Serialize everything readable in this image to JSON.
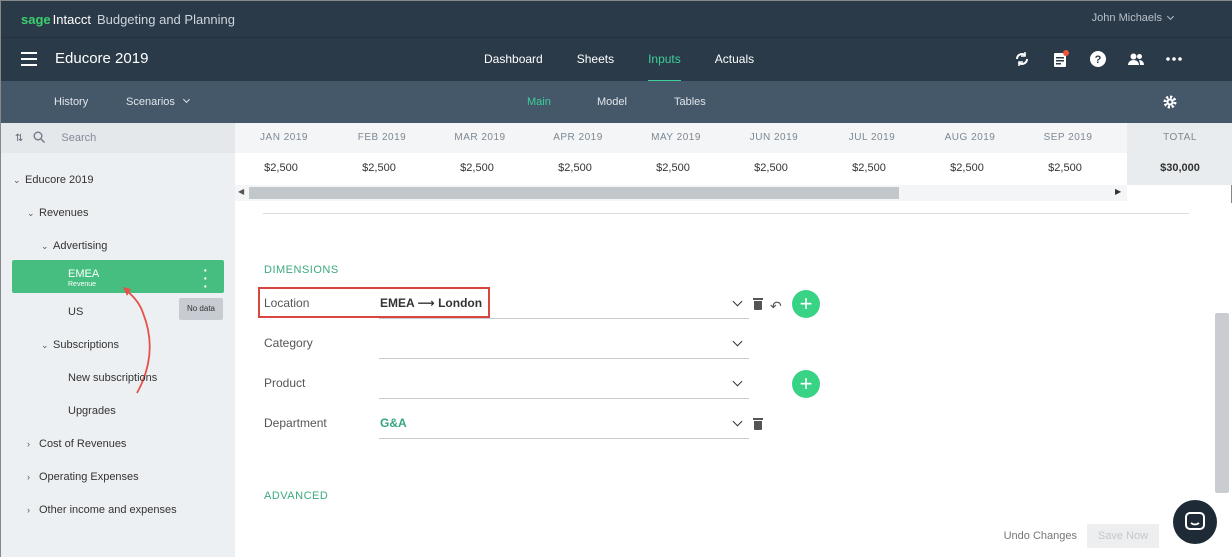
{
  "brand": {
    "sage": "sage",
    "intacct": "Intacct",
    "product": "Budgeting and Planning"
  },
  "user": {
    "name": "John Michaels"
  },
  "app": {
    "title": "Educore 2019"
  },
  "main_tabs": [
    {
      "label": "Dashboard",
      "active": false
    },
    {
      "label": "Sheets",
      "active": false
    },
    {
      "label": "Inputs",
      "active": true
    },
    {
      "label": "Actuals",
      "active": false
    }
  ],
  "subbar": {
    "history": "History",
    "scenarios": "Scenarios",
    "tabs": [
      {
        "label": "Main",
        "active": true
      },
      {
        "label": "Model",
        "active": false
      },
      {
        "label": "Tables",
        "active": false
      }
    ]
  },
  "sidebar": {
    "search_placeholder": "Search",
    "tree": [
      {
        "label": "Educore 2019",
        "level": 0,
        "caret": "down"
      },
      {
        "label": "Revenues",
        "level": 1,
        "caret": "down"
      },
      {
        "label": "Advertising",
        "level": 2,
        "caret": "down"
      },
      {
        "label": "US",
        "level": 3,
        "caret": "none"
      },
      {
        "label": "Subscriptions",
        "level": 2,
        "caret": "down"
      },
      {
        "label": "New subscriptions",
        "level": 3,
        "caret": "none"
      },
      {
        "label": "Upgrades",
        "level": 3,
        "caret": "none"
      },
      {
        "label": "Cost of Revenues",
        "level": 1,
        "caret": "right"
      },
      {
        "label": "Operating Expenses",
        "level": 1,
        "caret": "right"
      },
      {
        "label": "Other income and expenses",
        "level": 1,
        "caret": "right"
      }
    ],
    "selected": {
      "label": "EMEA",
      "sublabel": "Revenue"
    },
    "nodata_tooltip": "No data"
  },
  "grid": {
    "months": [
      "JAN 2019",
      "FEB 2019",
      "MAR 2019",
      "APR 2019",
      "MAY 2019",
      "JUN 2019",
      "JUL 2019",
      "AUG 2019",
      "SEP 2019"
    ],
    "values": [
      "$2,500",
      "$2,500",
      "$2,500",
      "$2,500",
      "$2,500",
      "$2,500",
      "$2,500",
      "$2,500",
      "$2,500"
    ],
    "total_label": "TOTAL",
    "total_value": "$30,000"
  },
  "dimensions": {
    "title": "DIMENSIONS",
    "rows": [
      {
        "label": "Location",
        "value": "EMEA ⟶ London"
      },
      {
        "label": "Category",
        "value": ""
      },
      {
        "label": "Product",
        "value": ""
      },
      {
        "label": "Department",
        "value": "G&A"
      }
    ]
  },
  "advanced": {
    "title": "ADVANCED"
  },
  "footer": {
    "undo": "Undo Changes",
    "save": "Save Now"
  },
  "colors": {
    "accent": "#3ccf9a",
    "nav": "#2b3a48",
    "subnav": "#44586a",
    "selected": "#46be80",
    "highlight": "#d9453f"
  }
}
